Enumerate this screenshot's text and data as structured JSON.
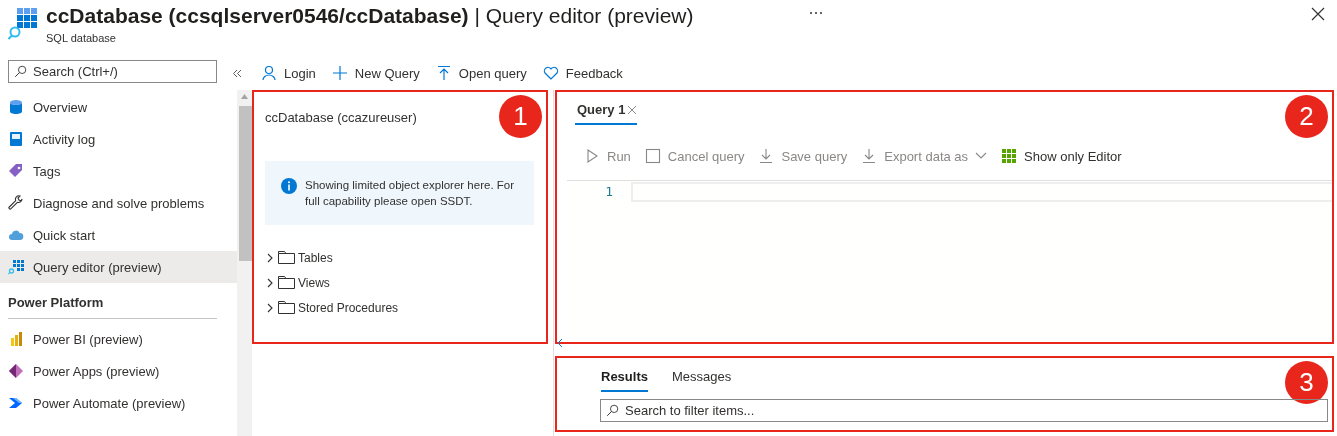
{
  "header": {
    "title": "**ccDatabase (ccsqlserver0546/ccDatabase)** | Query editor (preview)",
    "subtitle": "SQL database"
  },
  "sidebar": {
    "search": {
      "placeholder": "Search (Ctrl+/)"
    },
    "groups": [
      {
        "items": [
          {
            "label": "Overview",
            "selected": false
          },
          {
            "label": "Activity log",
            "selected": false
          },
          {
            "label": "Tags",
            "selected": false
          },
          {
            "label": "Diagnose and solve problems",
            "selected": false
          },
          {
            "label": "Quick start",
            "selected": false
          },
          {
            "label": "Query editor (preview)",
            "selected": true
          }
        ]
      },
      {
        "title": "Power Platform",
        "items": [
          {
            "label": "Power BI (preview)",
            "selected": false
          },
          {
            "label": "Power Apps (preview)",
            "selected": false
          },
          {
            "label": "Power Automate (preview)",
            "selected": false
          }
        ]
      }
    ]
  },
  "toolbar": [
    "Login",
    "New Query",
    "Open query",
    "Feedback"
  ],
  "explorer": {
    "callout": "1",
    "connection": "ccDatabase (ccazureuser)",
    "info": "Showing limited object explorer here. For full capability please open SSDT.",
    "tree": [
      {
        "label": "Tables",
        "expanded": false
      },
      {
        "label": "Views",
        "expanded": false
      },
      {
        "label": "Stored Procedures",
        "expanded": false
      }
    ]
  },
  "editor": {
    "callout": "2",
    "tabs": [
      {
        "label": "Query 1",
        "selected": true
      }
    ],
    "commands": [
      {
        "label": "Run",
        "kind": "button",
        "disabled": true
      },
      {
        "label": "Cancel query",
        "kind": "button",
        "disabled": true
      },
      {
        "label": "Save query",
        "kind": "button",
        "disabled": true
      },
      {
        "label": "Export data as",
        "kind": "dropdown",
        "disabled": true
      },
      {
        "label": "Show only Editor",
        "kind": "button",
        "disabled": false
      }
    ],
    "line_numbers": [
      "1"
    ]
  },
  "results": {
    "callout": "3",
    "tabs": [
      {
        "label": "Results",
        "selected": true
      },
      {
        "label": "Messages",
        "selected": false
      }
    ],
    "search": {
      "placeholder": "Search to filter items..."
    }
  }
}
